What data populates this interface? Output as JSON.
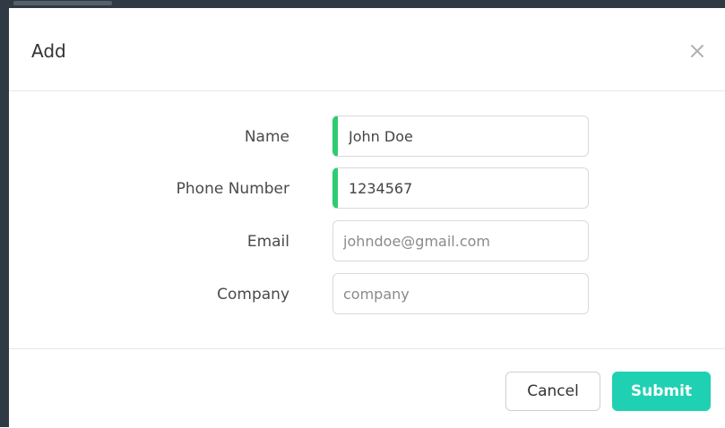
{
  "dialog": {
    "title": "Add",
    "close_icon": "close-icon"
  },
  "form": {
    "fields": [
      {
        "label": "Name",
        "value": "John Doe",
        "placeholder": "",
        "valid": true
      },
      {
        "label": "Phone Number",
        "value": "1234567",
        "placeholder": "",
        "valid": true
      },
      {
        "label": "Email",
        "value": "",
        "placeholder": "johndoe@gmail.com",
        "valid": false
      },
      {
        "label": "Company",
        "value": "",
        "placeholder": "company",
        "valid": false
      }
    ]
  },
  "footer": {
    "cancel_label": "Cancel",
    "submit_label": "Submit"
  },
  "colors": {
    "accent": "#1fd1b2",
    "valid_indicator": "#2ecc71"
  }
}
